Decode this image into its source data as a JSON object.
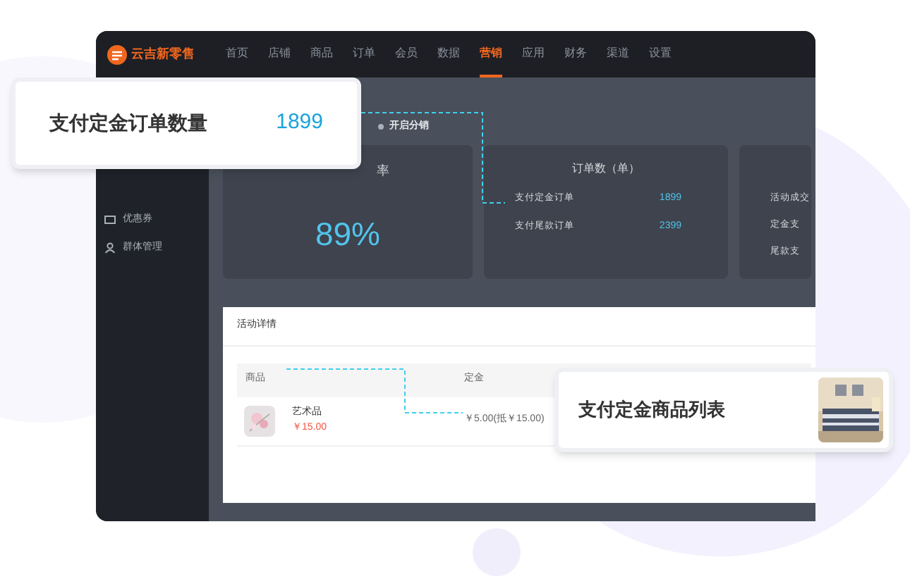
{
  "app": {
    "logo": "云吉新零售"
  },
  "nav": [
    {
      "label": "首页",
      "selected": false
    },
    {
      "label": "店铺",
      "selected": false
    },
    {
      "label": "商品",
      "selected": false
    },
    {
      "label": "订单",
      "selected": false
    },
    {
      "label": "会员",
      "selected": false
    },
    {
      "label": "数据",
      "selected": false
    },
    {
      "label": "营销",
      "selected": true
    },
    {
      "label": "应用",
      "selected": false
    },
    {
      "label": "财务",
      "selected": false
    },
    {
      "label": "渠道",
      "selected": false
    },
    {
      "label": "设置",
      "selected": false
    }
  ],
  "sidebar": {
    "items": [
      {
        "label": "优惠券",
        "kind": "ticket"
      },
      {
        "label": "群体管理",
        "kind": "person"
      }
    ]
  },
  "toolbar": {
    "label": "开启分销"
  },
  "stat_cards": [
    {
      "kind": "big",
      "title": "率",
      "value": "89%"
    },
    {
      "kind": "list",
      "title": "订单数（单）",
      "rows": [
        {
          "label": "支付定金订单",
          "value": "1899"
        },
        {
          "label": "支付尾款订单",
          "value": "2399"
        }
      ]
    },
    {
      "kind": "list",
      "rows": [
        {
          "label": "活动成交"
        },
        {
          "label": "定金支"
        },
        {
          "label": "尾款支"
        }
      ]
    }
  ],
  "details": {
    "title": "活动详情",
    "columns": [
      "商品",
      "定金"
    ],
    "rows": [
      {
        "name": "艺术品",
        "price": "￥15.00",
        "deposit": "￥5.00(抵￥15.00)"
      }
    ]
  },
  "callouts": [
    {
      "label": "支付定金订单数量",
      "value": "1899"
    },
    {
      "label": "支付定金商品列表",
      "kind": "picture"
    }
  ]
}
